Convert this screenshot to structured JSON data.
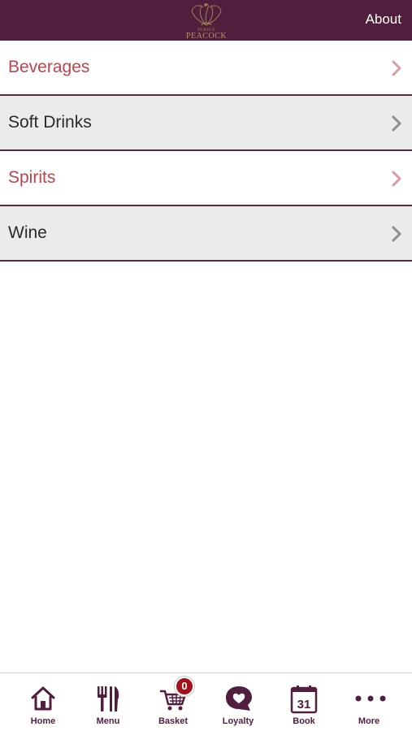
{
  "header": {
    "logo_top": "PURPLE",
    "logo_main": "PEACOCK",
    "about_label": "About"
  },
  "menu": {
    "items": [
      {
        "label": "Beverages"
      },
      {
        "label": "Soft Drinks"
      },
      {
        "label": "Spirits"
      },
      {
        "label": "Wine"
      }
    ]
  },
  "tabbar": {
    "tabs": [
      {
        "label": "Home",
        "icon": "home-icon"
      },
      {
        "label": "Menu",
        "icon": "fork-knife-icon"
      },
      {
        "label": "Basket",
        "icon": "cart-icon"
      },
      {
        "label": "Loyalty",
        "icon": "heart-bubble-icon"
      },
      {
        "label": "Book",
        "icon": "calendar-icon"
      },
      {
        "label": "More",
        "icon": "more-dots-icon"
      }
    ],
    "basket_count": "0",
    "calendar_day": "31"
  },
  "colors": {
    "brand": "#521e3d",
    "accent_text": "#c0424c",
    "badge": "#a3111a",
    "logo_gold": "#b09a5e"
  }
}
